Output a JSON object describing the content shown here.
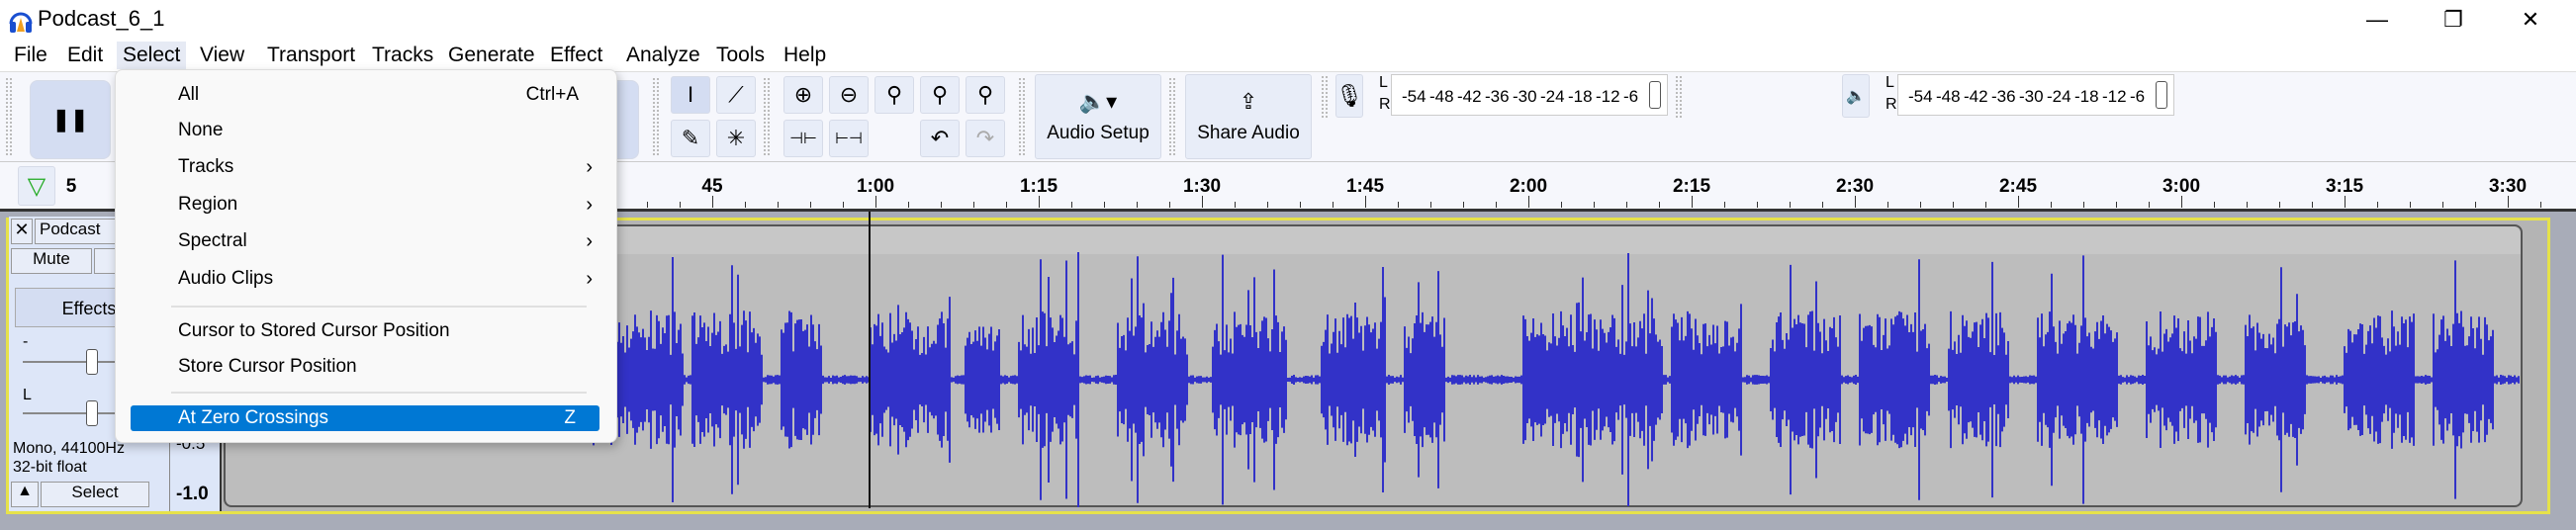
{
  "window": {
    "title": "Podcast_6_1",
    "controls": [
      "minimize",
      "restore",
      "close"
    ]
  },
  "menubar": [
    "File",
    "Edit",
    "Select",
    "View",
    "Transport",
    "Tracks",
    "Generate",
    "Effect",
    "Analyze",
    "Tools",
    "Help"
  ],
  "select_menu": {
    "items": [
      {
        "label": "All",
        "shortcut": "Ctrl+A"
      },
      {
        "label": "None"
      },
      {
        "label": "Tracks",
        "submenu": true
      },
      {
        "label": "Region",
        "submenu": true
      },
      {
        "label": "Spectral",
        "submenu": true
      },
      {
        "label": "Audio Clips",
        "submenu": true
      },
      {
        "label": "Cursor to Stored Cursor Position"
      },
      {
        "label": "Store Cursor Position"
      },
      {
        "label": "At Zero Crossings",
        "shortcut": "Z",
        "highlighted": true
      }
    ],
    "submenu_arrow": "›"
  },
  "toolbar": {
    "audio_setup": "Audio Setup",
    "share_audio": "Share Audio",
    "meter_lr": [
      "L",
      "R"
    ],
    "meter_ticks": [
      "-54",
      "-48",
      "-42",
      "-36",
      "-30",
      "-24",
      "-18",
      "-12",
      "-6"
    ]
  },
  "ruler": {
    "left_label": "5",
    "labels": [
      "45",
      "1:00",
      "1:15",
      "1:30",
      "1:45",
      "2:00",
      "2:15",
      "2:30",
      "2:45",
      "3:00",
      "3:15",
      "3:30"
    ]
  },
  "track": {
    "name": "Podcast",
    "mute": "Mute",
    "effects": "Effects",
    "gain_label": "-",
    "pan_label": "L",
    "info": [
      "Mono, 44100Hz",
      "32-bit float"
    ],
    "select": "Select",
    "scale": [
      "-0.5",
      "-1.0"
    ]
  },
  "colors": {
    "waveform": "#3232c8",
    "highlight": "#0078d4",
    "track_border": "#e6e24a"
  }
}
